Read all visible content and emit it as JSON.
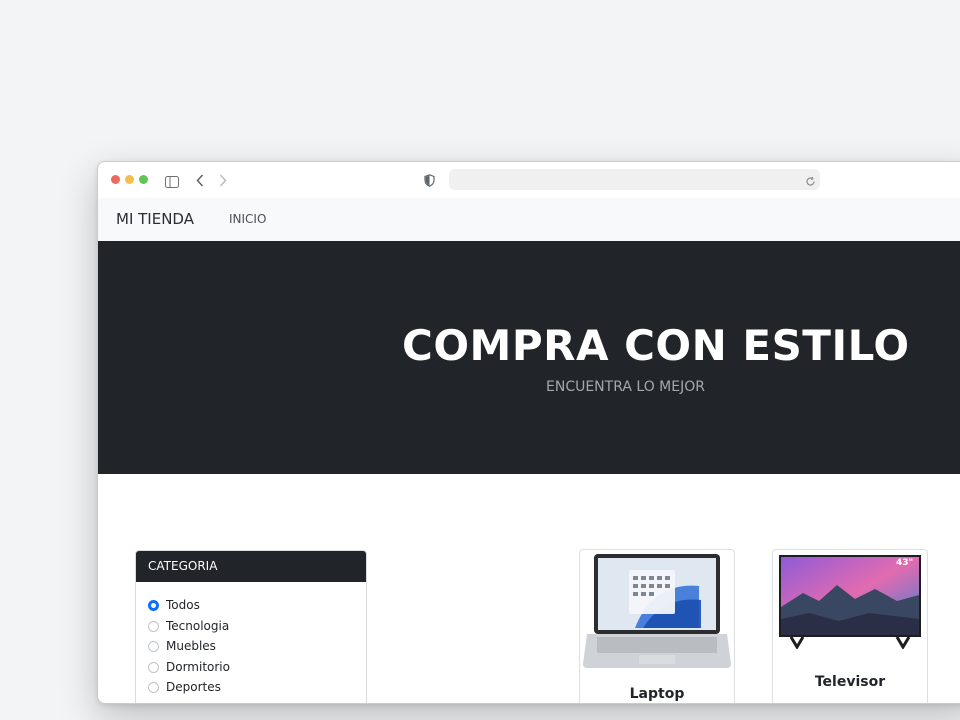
{
  "browser": {
    "dots": [
      "#ec6a5e",
      "#f4bf4f",
      "#61c554"
    ],
    "url": ""
  },
  "navbar": {
    "brand": "MI TIENDA",
    "links": [
      "INICIO"
    ]
  },
  "hero": {
    "title": "COMPRA CON ESTILO",
    "subtitle": "ENCUENTRA LO MEJOR"
  },
  "categories": {
    "header": "CATEGORIA",
    "options": [
      "Todos",
      "Tecnologia",
      "Muebles",
      "Dormitorio",
      "Deportes"
    ],
    "selected": "Todos"
  },
  "products": [
    {
      "name": "Laptop",
      "icon": "laptop-image"
    },
    {
      "name": "Televisor",
      "icon": "tv-image",
      "badge": "43\""
    }
  ],
  "colors": {
    "hero_bg": "#212529",
    "accent": "#0d6efd"
  }
}
